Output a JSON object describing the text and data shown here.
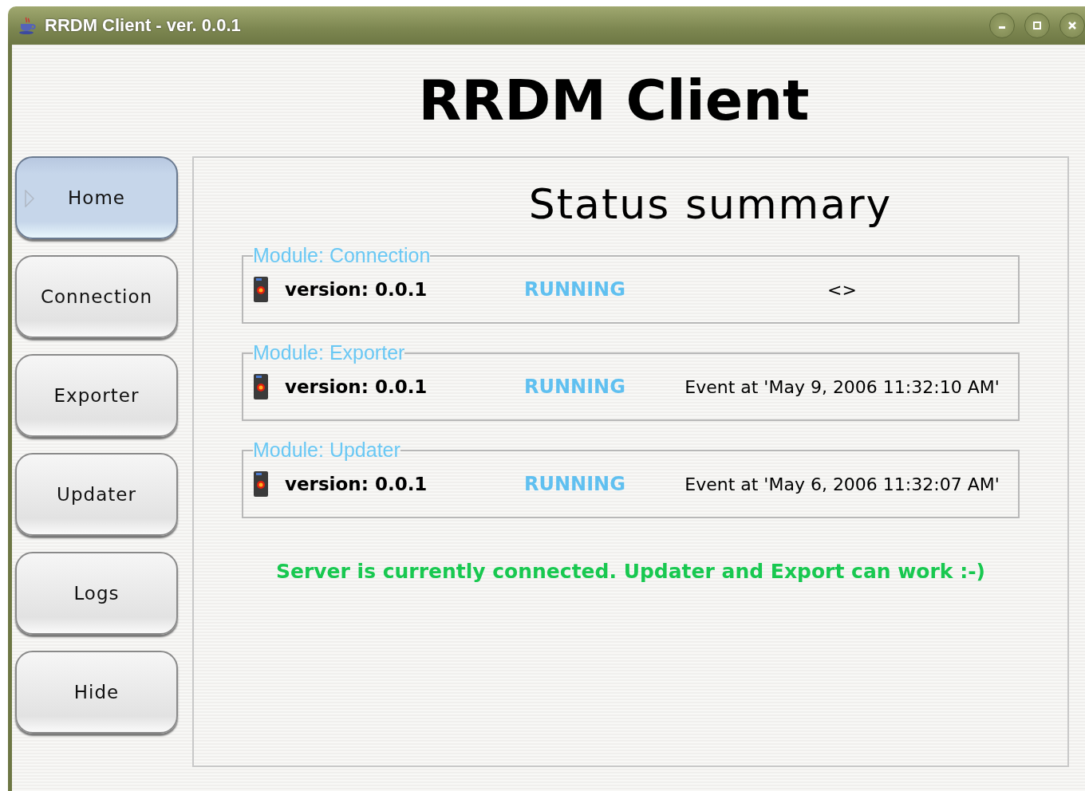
{
  "window": {
    "title": "RRDM Client - ver. 0.0.1"
  },
  "heading": "RRDM Client",
  "nav": [
    {
      "label": "Home",
      "selected": true
    },
    {
      "label": "Connection",
      "selected": false
    },
    {
      "label": "Exporter",
      "selected": false
    },
    {
      "label": "Updater",
      "selected": false
    },
    {
      "label": "Logs",
      "selected": false
    },
    {
      "label": "Hide",
      "selected": false
    }
  ],
  "panel": {
    "title": "Status summary",
    "modules": [
      {
        "title": "Module: Connection",
        "version": "version: 0.0.1",
        "status": "RUNNING",
        "event": "<>"
      },
      {
        "title": "Module: Exporter",
        "version": "version: 0.0.1",
        "status": "RUNNING",
        "event": "Event at 'May 9, 2006 11:32:10 AM'"
      },
      {
        "title": "Module: Updater",
        "version": "version: 0.0.1",
        "status": "RUNNING",
        "event": "Event at 'May 6, 2006 11:32:07 AM'"
      }
    ],
    "message": "Server is currently connected. Updater and Export can work  :-)"
  }
}
